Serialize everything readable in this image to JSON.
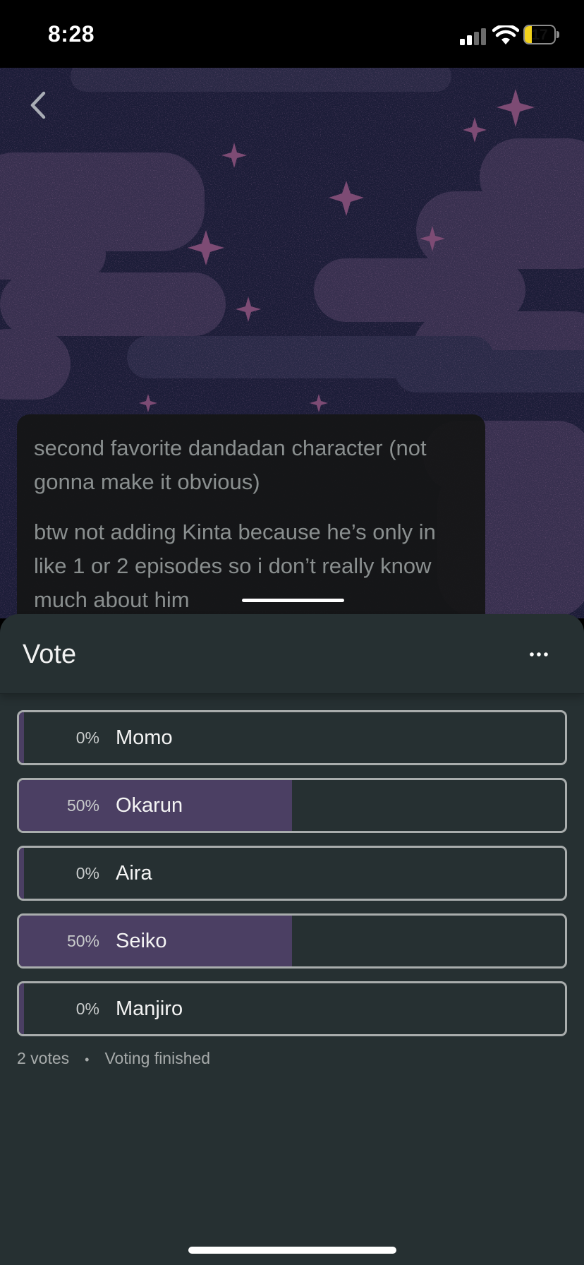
{
  "status_bar": {
    "time": "8:28",
    "battery_level": "17"
  },
  "nav": {
    "back_icon": "chevron-left-icon"
  },
  "post": {
    "description_line_1": "second favorite dandadan character (not gonna make it obvious)",
    "description_line_2": "btw not adding Kinta because he’s only in like 1 or 2 episodes so i don’t really know much about him"
  },
  "vote_sheet": {
    "title": "Vote",
    "more_icon": "ellipsis-icon",
    "options": [
      {
        "percent_label": "0%",
        "label": "Momo",
        "fraction": 0.0
      },
      {
        "percent_label": "50%",
        "label": "Okarun",
        "fraction": 0.5
      },
      {
        "percent_label": "0%",
        "label": "Aira",
        "fraction": 0.0
      },
      {
        "percent_label": "50%",
        "label": "Seiko",
        "fraction": 0.5
      },
      {
        "percent_label": "0%",
        "label": "Manjiro",
        "fraction": 0.0
      }
    ],
    "votes_count": "2 votes",
    "separator": "•",
    "status": "Voting finished"
  },
  "colors": {
    "sheet_background": "#263032",
    "result_bar": "#4b3f63",
    "option_border": "#a9adad",
    "art_background": "#1d1f3a",
    "art_clouds": "#3a3050",
    "art_stars": "#a34f84"
  }
}
